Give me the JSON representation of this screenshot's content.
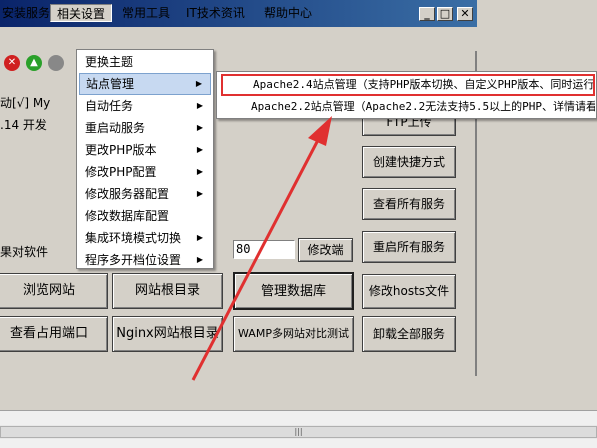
{
  "menubar": {
    "items": [
      {
        "label": "安装服务"
      },
      {
        "label": "相关设置"
      },
      {
        "label": "常用工具"
      },
      {
        "label": "IT技术资讯"
      },
      {
        "label": "帮助中心"
      }
    ]
  },
  "window_buttons": {
    "minimize": "_",
    "maximize": "□",
    "close": "✕"
  },
  "info": {
    "line1": "动[√] My",
    "line2": ".14 开发",
    "partial_label": "果对软件",
    "port_value": "80"
  },
  "buttons": {
    "edit_port": "修改端",
    "partial_upload": "FTP上传",
    "create_shortcut": "创建快捷方式",
    "view_all_services": "查看所有服务",
    "restart_all_services": "重启所有服务",
    "browse_site": "浏览网站",
    "site_root": "网站根目录",
    "manage_db": "管理数据库",
    "edit_hosts": "修改hosts文件",
    "view_ports": "查看占用端口",
    "nginx_root": "Nginx网站根目录",
    "wamp_compare": "WAMP多网站对比测试",
    "uninstall_all": "卸载全部服务"
  },
  "dropdown": {
    "items": [
      {
        "label": "更换主题",
        "arrow": ""
      },
      {
        "label": "站点管理",
        "arrow": "▶"
      },
      {
        "label": "自动任务",
        "arrow": "▶"
      },
      {
        "label": "重启动服务",
        "arrow": "▶"
      },
      {
        "label": "更改PHP版本",
        "arrow": "▶"
      },
      {
        "label": "修改PHP配置",
        "arrow": "▶"
      },
      {
        "label": "修改服务器配置",
        "arrow": "▶"
      },
      {
        "label": "修改数据库配置",
        "arrow": ""
      },
      {
        "label": "集成环境模式切换",
        "arrow": "▶"
      },
      {
        "label": "程序多开档位设置",
        "arrow": "▶"
      }
    ]
  },
  "submenu": {
    "items": [
      {
        "label": "Apache2.4站点管理（支持PHP版本切换、自定义PHP版本、同时运行"
      },
      {
        "label": "Apache2.2站点管理（Apache2.2无法支持5.5以上的PHP、详情请看"
      }
    ]
  },
  "scrollbar": {
    "grip": "|||"
  },
  "colors": {
    "highlight_border": "#e03030",
    "menu_highlight": "#c7d9f1",
    "title_bar": "#0a246a"
  }
}
